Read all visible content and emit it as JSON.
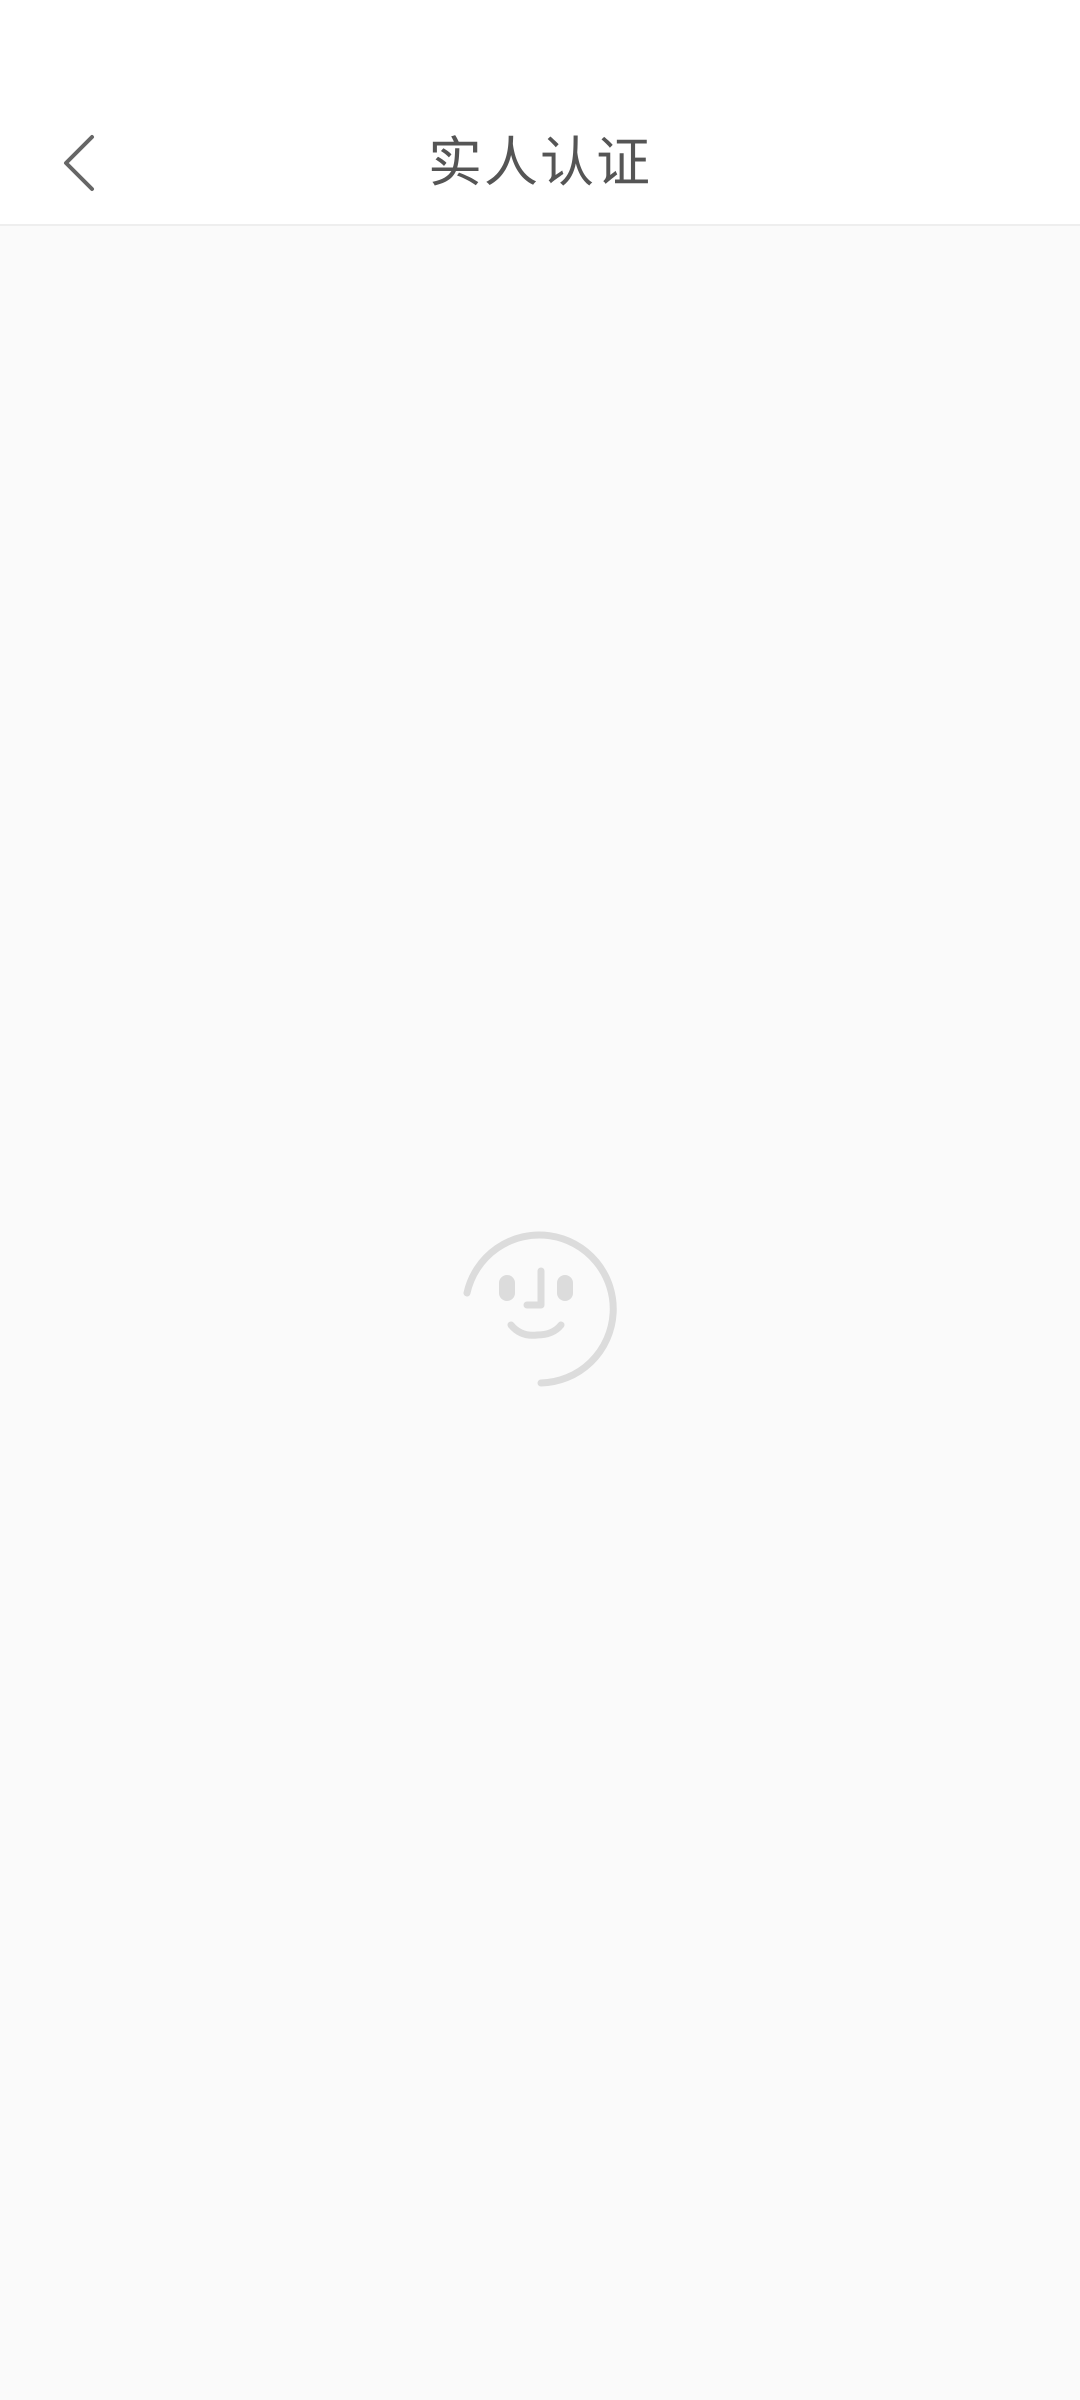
{
  "header": {
    "title": "实人认证",
    "back_icon": "chevron-left-icon"
  },
  "loader": {
    "icon": "face-scan-icon"
  },
  "colors": {
    "title": "#555555",
    "background": "#fafafa",
    "loader": "#dcdcdc"
  }
}
